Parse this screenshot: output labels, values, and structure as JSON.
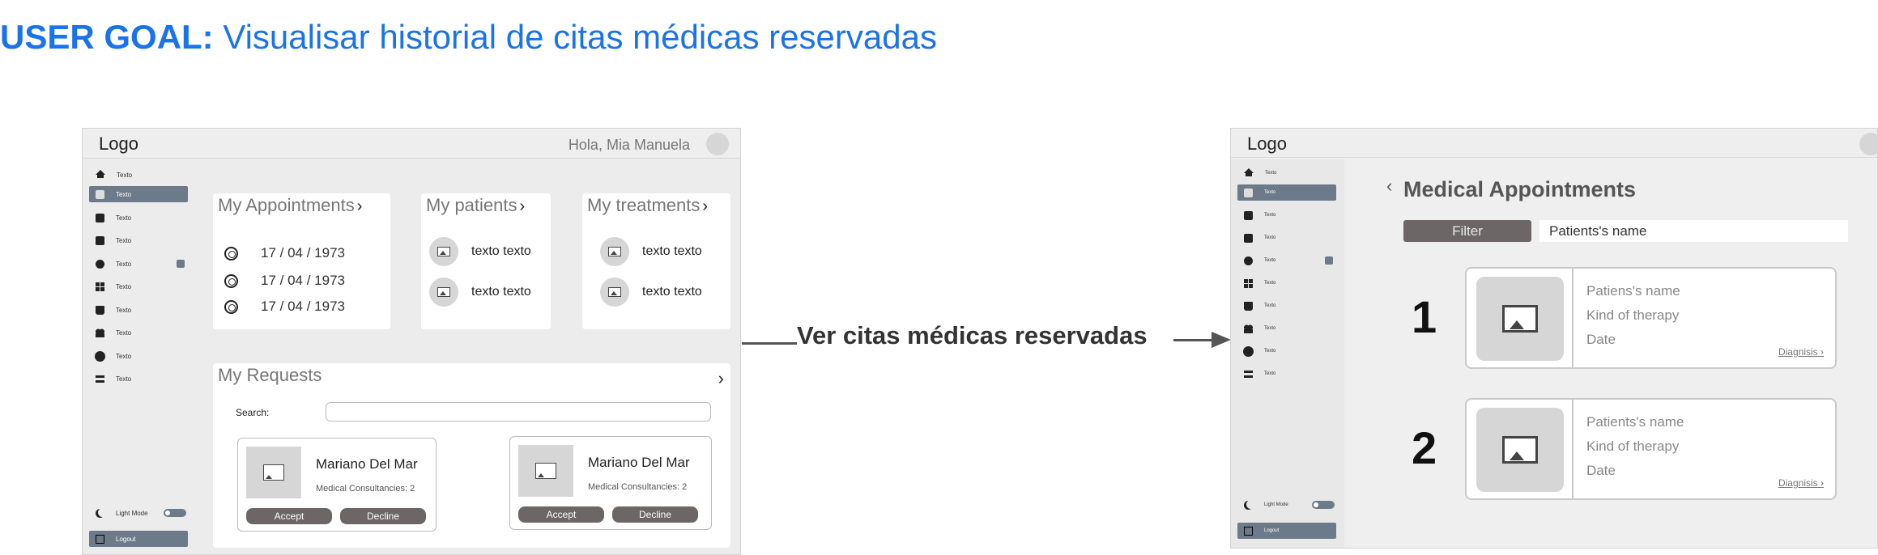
{
  "user_goal": {
    "prefix": "USER GOAL:",
    "text": " Visualisar historial de citas médicas reservadas"
  },
  "screen1": {
    "logo": "Logo",
    "greeting": "Hola, Mia Manuela",
    "sidebar": {
      "items": [
        {
          "label": "Texto",
          "icon": "home-icon"
        },
        {
          "label": "Texto",
          "icon": "edit-icon",
          "active": true
        },
        {
          "label": "Texto",
          "icon": "profile-card-icon"
        },
        {
          "label": "Texto",
          "icon": "document-icon"
        },
        {
          "label": "Texto",
          "icon": "chat-icon",
          "badge": true
        },
        {
          "label": "Texto",
          "icon": "grid-icon"
        },
        {
          "label": "Texto",
          "icon": "bag-icon"
        },
        {
          "label": "Texto",
          "icon": "people-icon"
        },
        {
          "label": "Texto",
          "icon": "gear-icon"
        },
        {
          "label": "Texto",
          "icon": "toggles-icon"
        }
      ],
      "light_mode": "Light Mode",
      "toggle_text": "Off",
      "logout": "Logout"
    },
    "appointments": {
      "title": "My Appointments",
      "dates": [
        "17 / 04 / 1973",
        "17 / 04 / 1973",
        "17 / 04 / 1973"
      ]
    },
    "patients": {
      "title": "My patients",
      "items": [
        "texto texto",
        "texto texto"
      ]
    },
    "treatments": {
      "title": "My treatments",
      "items": [
        "texto texto",
        "texto texto"
      ]
    },
    "requests": {
      "title": "My Requests",
      "search_label": "Search:",
      "cards": [
        {
          "name": "Mariano Del Mar",
          "sub": "Medical Consultancies: 2",
          "accept": "Accept",
          "decline": "Decline"
        },
        {
          "name": "Mariano Del Mar",
          "sub": "Medical Consultancies: 2",
          "accept": "Accept",
          "decline": "Decline"
        }
      ]
    }
  },
  "transition": {
    "label": "Ver citas médicas reservadas"
  },
  "screen2": {
    "logo": "Logo",
    "title": "Medical Appointments",
    "filter_label": "Filter",
    "filter_value": "Patients's name",
    "appointments": [
      {
        "number": "1",
        "name": "Patiens's name",
        "therapy": "Kind of therapy",
        "date": "Date",
        "link": "Diagnisis"
      },
      {
        "number": "2",
        "name": "Patients's name",
        "therapy": "Kind of therapy",
        "date": "Date",
        "link": "Diagnisis"
      }
    ]
  },
  "colors": {
    "goal_blue": "#1a73e8",
    "active_item": "#6c7a89",
    "button_dark": "#6c6666"
  }
}
